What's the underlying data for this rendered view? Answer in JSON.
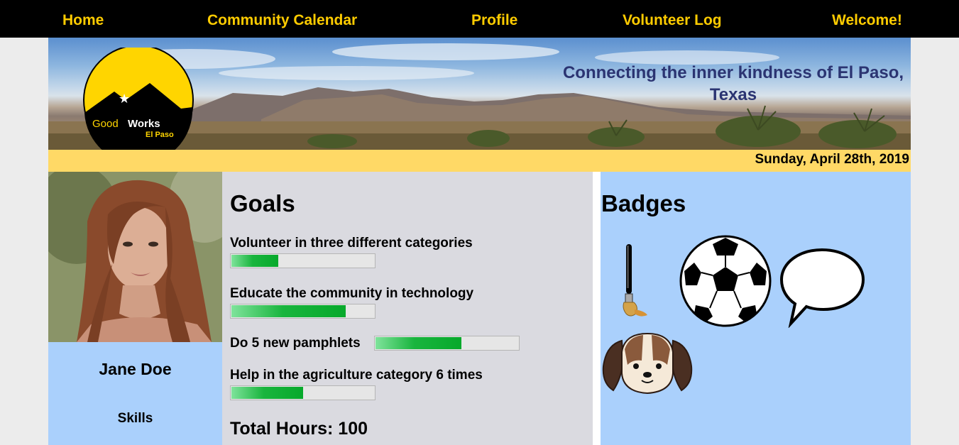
{
  "nav": {
    "home": "Home",
    "calendar": "Community Calendar",
    "profile": "Profile",
    "volunteer_log": "Volunteer Log",
    "welcome": "Welcome!"
  },
  "logo": {
    "line1": "Good",
    "line2": "Works",
    "line3": "El Paso"
  },
  "banner": {
    "tagline": "Connecting the inner kindness of El Paso, Texas"
  },
  "date": "Sunday, April 28th, 2019",
  "profile": {
    "name": "Jane Doe",
    "skills_label": "Skills"
  },
  "goals": {
    "heading": "Goals",
    "items": [
      {
        "label": "Volunteer in three different categories",
        "progress": 0.33
      },
      {
        "label": "Educate the community in technology",
        "progress": 0.8
      },
      {
        "label": "Do 5 new pamphlets",
        "progress": 0.6
      },
      {
        "label": "Help in the agriculture category 6 times",
        "progress": 0.5
      }
    ],
    "total_hours": "Total Hours: 100"
  },
  "badges": {
    "heading": "Badges",
    "items": [
      "paintbrush-icon",
      "soccer-ball-icon",
      "speech-bubble-icon",
      "puppy-icon"
    ]
  },
  "colors": {
    "nav_bg": "#000000",
    "nav_text": "#ffcc00",
    "date_bar": "#ffd966",
    "panel_blue": "#aad0fc",
    "panel_gray": "#dadae0",
    "tagline": "#2b3472",
    "progress_green": "#07a92b"
  }
}
